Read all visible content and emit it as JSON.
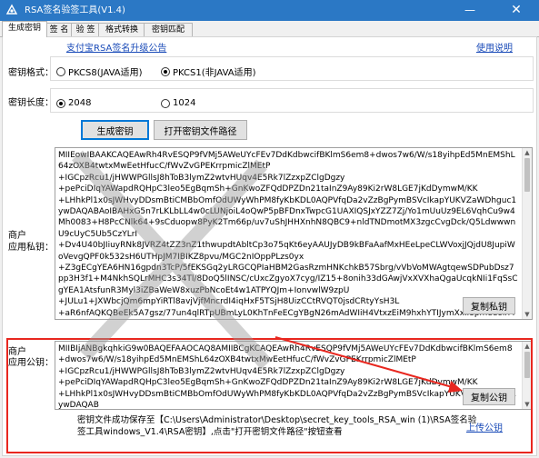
{
  "window": {
    "title": "RSA签名验签工具(V1.4)",
    "min_glyph": "—",
    "close_glyph": "✕"
  },
  "tabs": [
    {
      "label": "生成密钥",
      "active": true
    },
    {
      "label": "签 名",
      "active": false
    },
    {
      "label": "验 签",
      "active": false
    },
    {
      "label": "格式转换",
      "active": false
    },
    {
      "label": "密钥匹配",
      "active": false
    }
  ],
  "top_links": {
    "upgrade_notice": "支付宝RSA签名升级公告",
    "help": "使用说明"
  },
  "key_format": {
    "label": "密钥格式：",
    "options": [
      {
        "label": "PKCS8(JAVA适用)",
        "selected": false
      },
      {
        "label": "PKCS1(非JAVA适用)",
        "selected": true
      }
    ]
  },
  "key_length": {
    "label": "密钥长度：",
    "options": [
      {
        "label": "2048",
        "selected": true
      },
      {
        "label": "1024",
        "selected": false
      }
    ]
  },
  "buttons": {
    "generate": "生成密钥",
    "open_path": "打开密钥文件路径",
    "copy_private": "复制私钥",
    "copy_public": "复制公钥",
    "upload_public": "上传公钥"
  },
  "private_key": {
    "label_line1": "商户",
    "label_line2": "应用私钥：",
    "value": "MIIEowIBAAKCAQEAwRh4RvESQP9fVMj5AWeUYcFEv7DdKdbwcifBKlmS6em8+dwos7w6/W/s18yihpEd5MnEMShL64zOXB4twtxMwEetHfucC/fWvZvGPEKrrpmicZlMEtP\n+IGCpzRcu1/jHWWPGllsJ8hToB3lymZ2wtvHUqv4E5Rk7lZzxpZClgDgzy\n+pePciDIqYAWapdRQHpC3leo5EgBqmSh+GnKwoZFQdDPZDn21taInZ9Ay89Ki2rW8LGE7jKdDymwM/KK\n+LHhkPl1x0sJWHvyDDsmBtiCMBbOmfOdUWyWhPM8fyKbKDL0AQPVfqDa2vZzBgPymBSVcIkapYUKVZaWDhguc1ywDAQABAoIBAHxG5n7rLKLbLL4w0cLUNjoiL4oQwP5pBFDnxTwpcG1UAXIQSJxYZZ7Zj/Yo1mUuUz9EL6VqhCu9w4Mh0083+H8PcCNlk64+9sCduopw8PyK2Tm66p/uv7uShJHHXnhN8QBC9+nldTNDmotMX3zgcCvgDck/Q5LdwwwnU9cUyC5Ub5CzYLrI\n+Dv4U40bJIiuyRNk8JVRZ4tZZ3nZ1thwupdtAbltCp3o75qKt6eyAAUJyDB9kBFaAafMxHEeLpeCLWVoxjJQjdU8JupiWoVevgQPF0k532sH6UTHpJM7IBIKZ8pvu/MGC2nIOppPLzs0yx\n+Z3gECgYEA6HN16gpdn3TcP/5fEKSGq2yLRGCQPIaHBM2GasRzmHNKchkB57Sbrg/vVbVoMWAgtqewSDPubDsz7pp3H3f1+M4NkhSQLrMHC3s34Tl/8DoQ5lINSC/cUxcZgyoX7cyg/IZ15+8onih33dGAwjVxXVXhaQgaUcqkNIi1FqSsCgYEA1AtsfunR3Myl3iZBaWeW8xuzPbNcoEt4w1ATPYQJm+IonvwlW9zpU\n+JULu1+JXWbcjQm6mpYiRTl8avjVjfMncrdI4iqHxF5TSjH8UizCCtRVQT0jsdCRtyYsH3L\n+aR6nfAQKQBeEk5A7gsz/77un4qlRTpUBmLyL0KhTnFeECgYBgN26mAdWIiH4VtxzEiM9hxhYTIJymXxil8pmeeoln4Ag5",
    "scrollbar": {
      "thumb_fraction": 0.22
    }
  },
  "public_key": {
    "label_line1": "商户",
    "label_line2": "应用公钥：",
    "value": "MIIBIjANBgkqhkiG9w0BAQEFAAOCAQ8AMIIBCgKCAQEAwRh4RvESQP9fVMj5AWeUYcFEv7DdKdbwcifBKlmS6em8+dwos7w6/W/s18yihpEd5MnEMShL64zOXB4twtxMwEetHfucC/fWvZvGPEKrrpmicZlMEtP\n+IGCpzRcu1/jHWWPGllsJ8hToB3lymZ2wtvHUqv4E5Rk7lZzxpZClgDgzy\n+pePciDIqYAWapdRQHpC3leo5EgBqmSh+GnKwoZFQdDPZDn21taInZ9Ay89Ki2rW8LGE7jKdDymwM/KK\n+LHhkPl1x0sJWHvyDDsmBtiCMBbOmfOdUWyWhPM8fyKbKDL0AQPVfqDa2vZzBgPymBSVcIkapYUKVZaWDhguc1ywDAQAB",
    "scrollbar": {
      "thumb_fraction": 0.55
    }
  },
  "status": {
    "line1": "密钥文件成功保存至【C:\\Users\\Administrator\\Desktop\\secret_key_tools_RSA_win (1)\\RSA签名验",
    "line2": "签工具windows_V1.4\\RSA密钥】,点击\"打开密钥文件路径\"按钮查看"
  },
  "annotation": {
    "highlight_color": "#e8271f"
  }
}
